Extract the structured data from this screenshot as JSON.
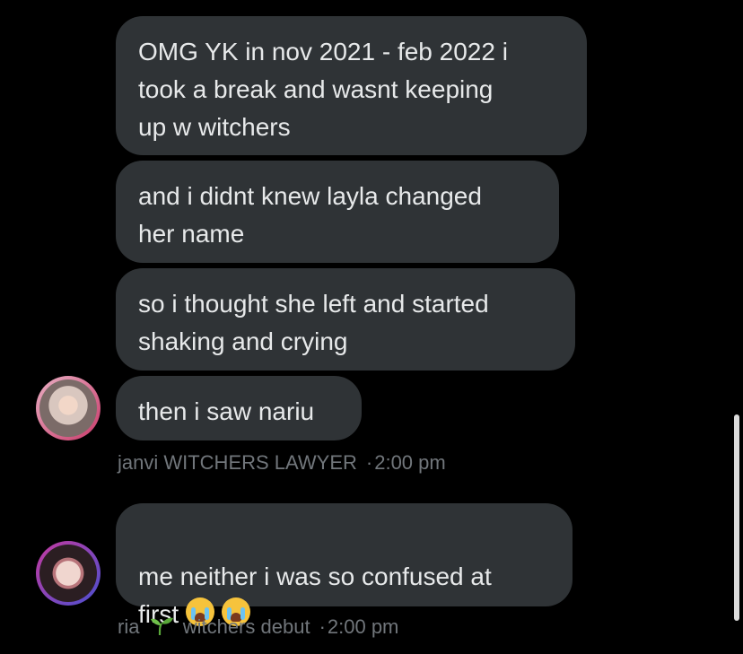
{
  "conversation": {
    "group_messages": [
      {
        "text": "OMG YK in nov 2021 - feb 2022 i\ntook a break and wasnt keeping\nup w witchers"
      },
      {
        "text": "and i didnt knew layla changed\nher name"
      },
      {
        "text": "so i thought she left and started\nshaking and crying"
      },
      {
        "text": "then i saw nariu"
      }
    ],
    "group_meta": {
      "sender": "janvi WITCHERS LAWYER",
      "separator": "·",
      "time": "2:00 pm"
    },
    "reply": {
      "text": "me neither i was so confused at\nfirst",
      "emoji_names": [
        "loudly-crying-face",
        "loudly-crying-face"
      ]
    },
    "reply_meta": {
      "sender_name": "ria",
      "sender_emoji": "seedling",
      "sender_suffix": "witchers debut",
      "separator": "·",
      "time": "2:00 pm"
    }
  },
  "colors": {
    "background": "#000000",
    "bubble": "#2f3336",
    "text": "#e7e9ea",
    "meta_text": "#71767b",
    "scrollbar": "#dcdcdc"
  }
}
